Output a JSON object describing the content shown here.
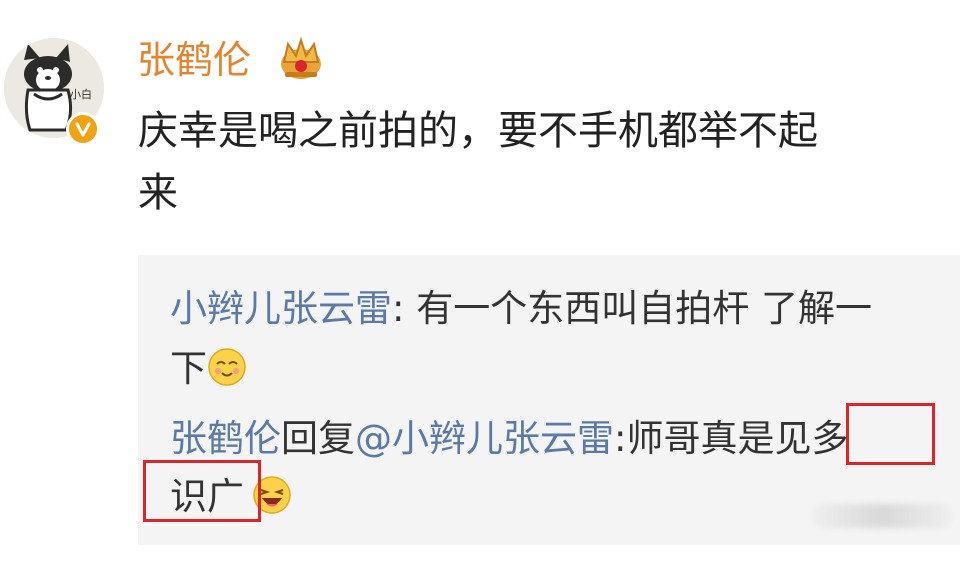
{
  "post": {
    "username": "张鹤伦",
    "text_line1": "庆幸是喝之前拍的，要不手机都举不起",
    "text_line2": "来"
  },
  "replies": [
    {
      "author": "小辫儿张云雷",
      "separator": ":",
      "text_line1": " 有一个东西叫自拍杆 了解一",
      "text_line2": "下"
    },
    {
      "author": "张鹤伦",
      "reply_word": "回复",
      "mention": "@小辫儿张云雷",
      "separator": ":",
      "text_plain": "师哥真是",
      "text_highlight": "见多",
      "text_line2": "识广"
    }
  ],
  "icons": {
    "crown": "crown-icon",
    "verified": "verified-badge-icon",
    "emoji_1": "smiling-emoji-icon",
    "emoji_2": "laughing-emoji-icon"
  },
  "colors": {
    "username": "#e6832d",
    "link": "#5b7aa8",
    "text": "#222222",
    "reply_bg": "#f4f4f4",
    "highlight_box": "#d9252c",
    "badge": "#f2a315"
  }
}
